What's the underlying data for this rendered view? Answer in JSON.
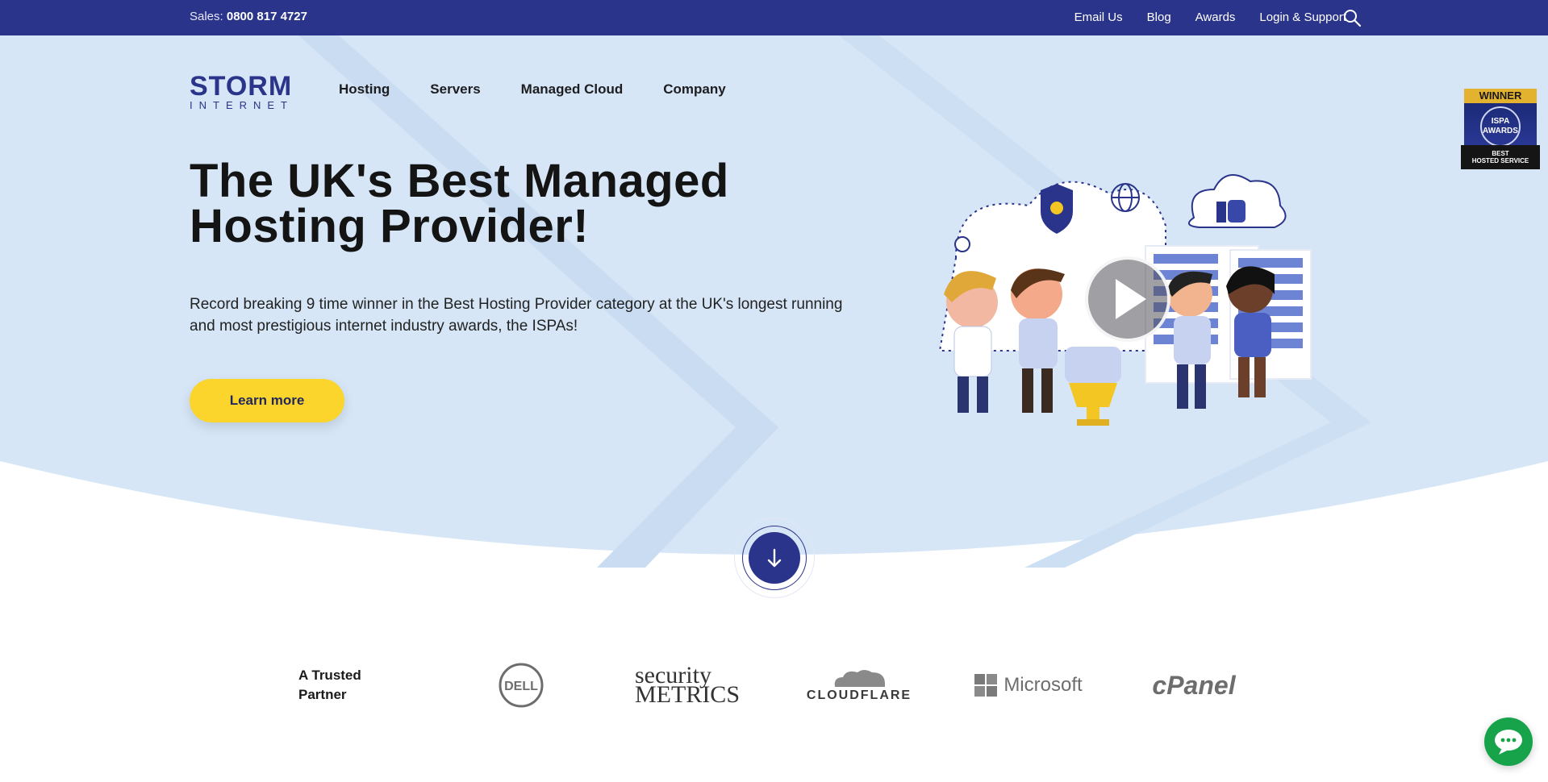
{
  "topbar": {
    "sales_label": "Sales:",
    "sales_phone": "0800 817 4727",
    "links": [
      "Email Us",
      "Blog",
      "Awards",
      "Login & Support"
    ],
    "search_icon": "search-icon"
  },
  "logo": {
    "line1": "STORM",
    "line2": "INTERNET"
  },
  "nav": [
    "Hosting",
    "Servers",
    "Managed Cloud",
    "Company"
  ],
  "hero": {
    "title": "The UK's Best Managed Hosting Provider!",
    "subtitle": "Record breaking 9 time winner in the Best Hosting Provider category at the UK's longest running and most prestigious internet industry awards, the ISPAs!",
    "cta": "Learn more",
    "play_icon": "play-icon"
  },
  "badge": {
    "top": "WINNER",
    "seal": "ISPA AWARDS",
    "bottom1": "BEST",
    "bottom2": "HOSTED SERVICE"
  },
  "scroll_icon": "arrow-down-icon",
  "partners": {
    "label": "A Trusted Partner",
    "logos": [
      "DELL",
      "security METRICS",
      "CLOUDFLARE",
      "Microsoft",
      "cPanel"
    ]
  },
  "chat_icon": "chat-bubble-icon",
  "colors": {
    "navy": "#29348a",
    "hero_bg": "#d6e6f6",
    "cta": "#fbd52b",
    "chat": "#16a34a"
  }
}
